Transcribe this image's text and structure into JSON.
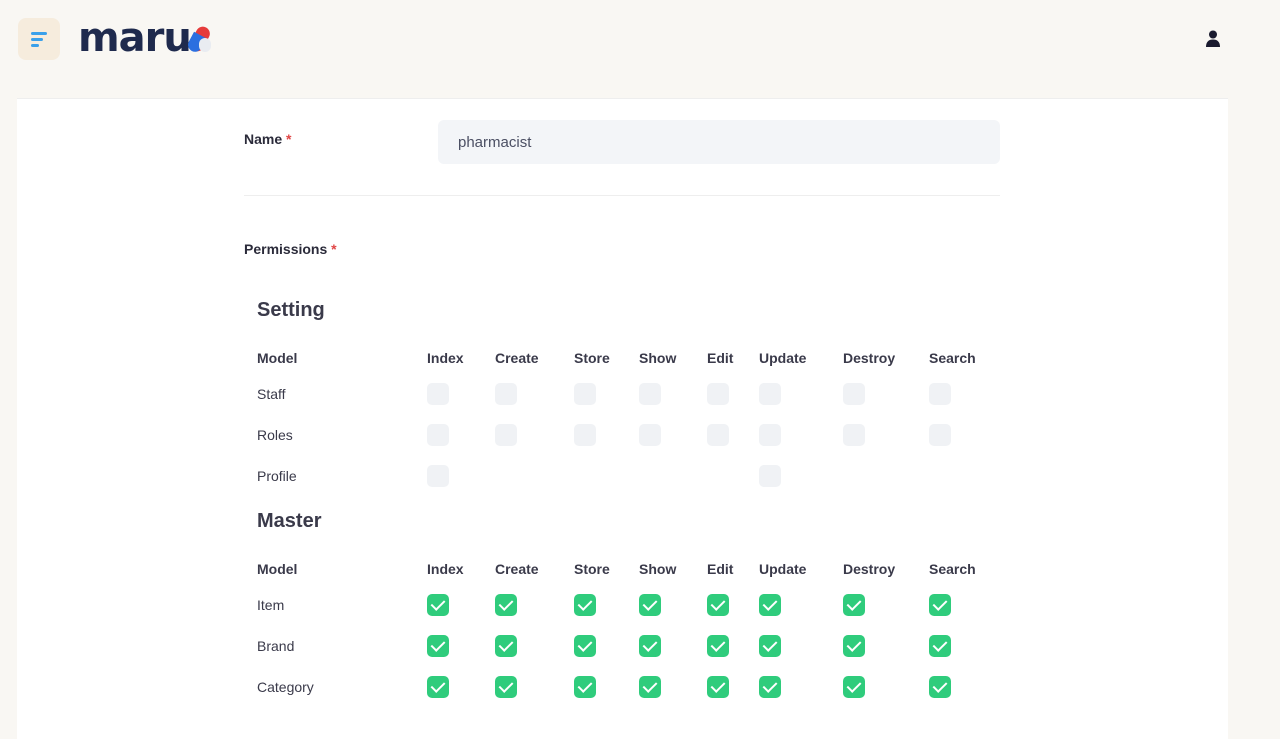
{
  "header": {
    "brand": "maru",
    "menu_icon": "menu-icon",
    "user_icon": "user-icon"
  },
  "form": {
    "name_label": "Name",
    "required_mark": "*",
    "name_value": "pharmacist",
    "permissions_label": "Permissions"
  },
  "columns": [
    "Model",
    "Index",
    "Create",
    "Store",
    "Show",
    "Edit",
    "Update",
    "Destroy",
    "Search"
  ],
  "sections": [
    {
      "title": "Setting",
      "rows": [
        {
          "model": "Staff",
          "perms": [
            false,
            false,
            false,
            false,
            false,
            false,
            false,
            false
          ],
          "available": [
            true,
            true,
            true,
            true,
            true,
            true,
            true,
            true
          ]
        },
        {
          "model": "Roles",
          "perms": [
            false,
            false,
            false,
            false,
            false,
            false,
            false,
            false
          ],
          "available": [
            true,
            true,
            true,
            true,
            true,
            true,
            true,
            true
          ]
        },
        {
          "model": "Profile",
          "perms": [
            false,
            false,
            false,
            false,
            false,
            false,
            false,
            false
          ],
          "available": [
            true,
            false,
            false,
            false,
            false,
            true,
            false,
            false
          ]
        }
      ]
    },
    {
      "title": "Master",
      "rows": [
        {
          "model": "Item",
          "perms": [
            true,
            true,
            true,
            true,
            true,
            true,
            true,
            true
          ],
          "available": [
            true,
            true,
            true,
            true,
            true,
            true,
            true,
            true
          ]
        },
        {
          "model": "Brand",
          "perms": [
            true,
            true,
            true,
            true,
            true,
            true,
            true,
            true
          ],
          "available": [
            true,
            true,
            true,
            true,
            true,
            true,
            true,
            true
          ]
        },
        {
          "model": "Category",
          "perms": [
            true,
            true,
            true,
            true,
            true,
            true,
            true,
            true
          ],
          "available": [
            true,
            true,
            true,
            true,
            true,
            true,
            true,
            true
          ]
        }
      ]
    }
  ],
  "colors": {
    "accent_green": "#2fcc7c",
    "menu_blue": "#3aa0ea",
    "brand_navy": "#1f2a4d",
    "required_red": "#e04545"
  }
}
